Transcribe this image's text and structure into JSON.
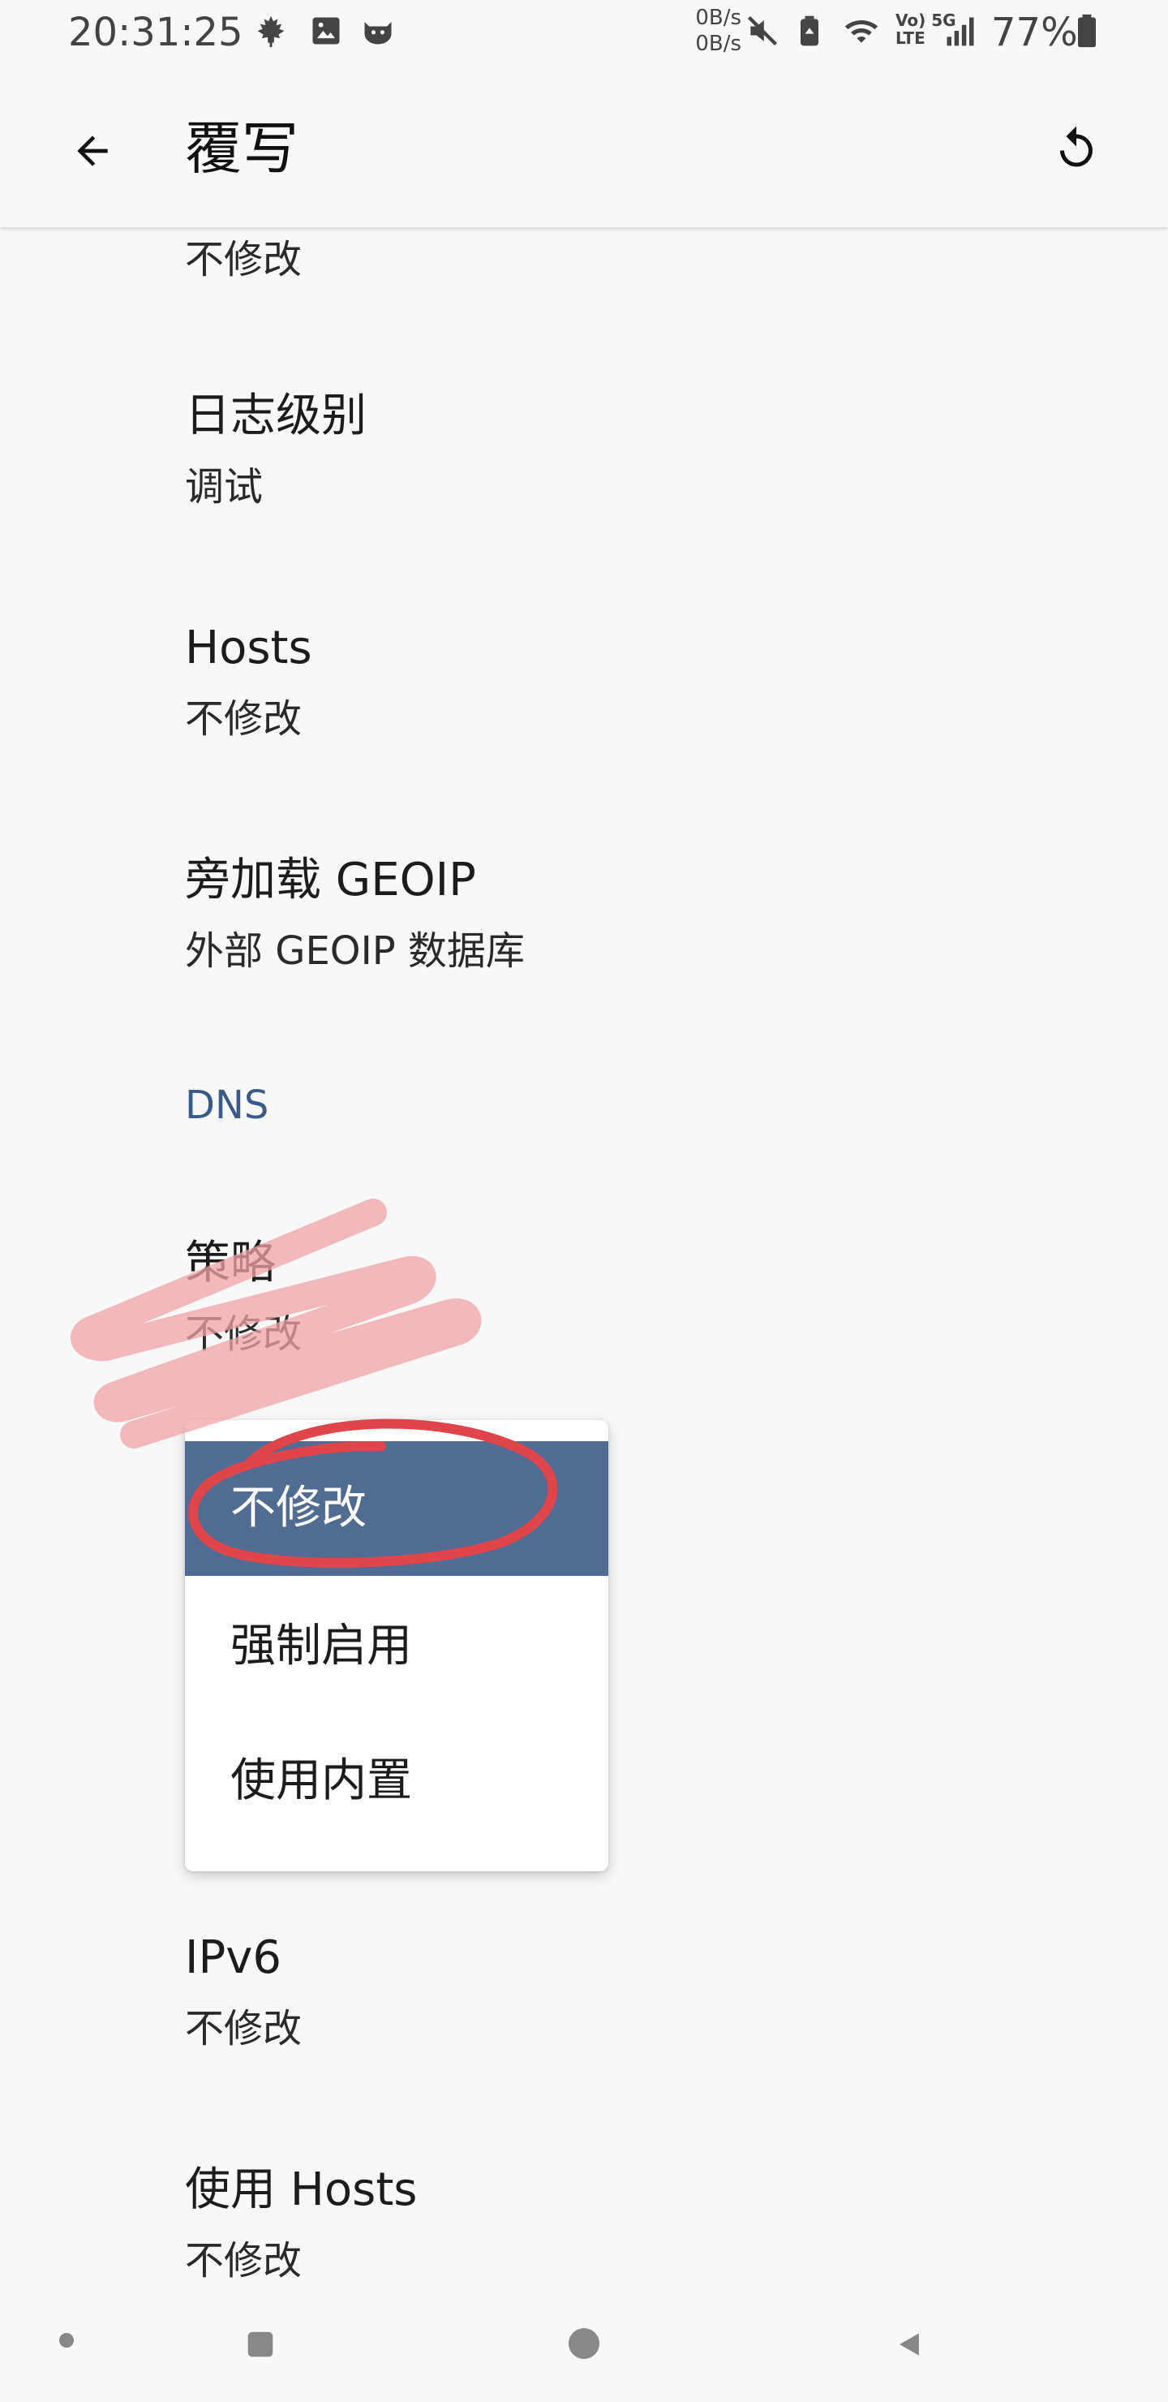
{
  "status_bar": {
    "time": "20:31:25",
    "net_up": "0B/s",
    "net_down": "0B/s",
    "net_type": "Vo) 5G\nLTE",
    "battery_percent": "77%"
  },
  "app_bar": {
    "title": "覆写",
    "back_icon": "arrow-back-icon",
    "reset_icon": "refresh-icon"
  },
  "preferences": {
    "mode": {
      "summary": "不修改"
    },
    "log_level": {
      "title": "日志级别",
      "summary": "调试"
    },
    "hosts": {
      "title": "Hosts",
      "summary": "不修改"
    },
    "sideload_geoip": {
      "title": "旁加载 GEOIP",
      "summary": "外部 GEOIP 数据库"
    },
    "dns_category": "DNS",
    "strategy": {
      "title": "策略",
      "summary": "不修改"
    },
    "ipv6": {
      "title": "IPv6",
      "summary": "不修改"
    },
    "use_hosts": {
      "title": "使用 Hosts",
      "summary": "不修改"
    }
  },
  "popup_menu": {
    "items": [
      "不修改",
      "强制启用",
      "使用内置"
    ],
    "selected_index": 0
  },
  "colors": {
    "background": "#f8f8f8",
    "accent_category": "#3a5a8a",
    "selected_item": "#526b93",
    "annotation_red": "#e0454a",
    "annotation_pink": "#f2a3a8"
  }
}
